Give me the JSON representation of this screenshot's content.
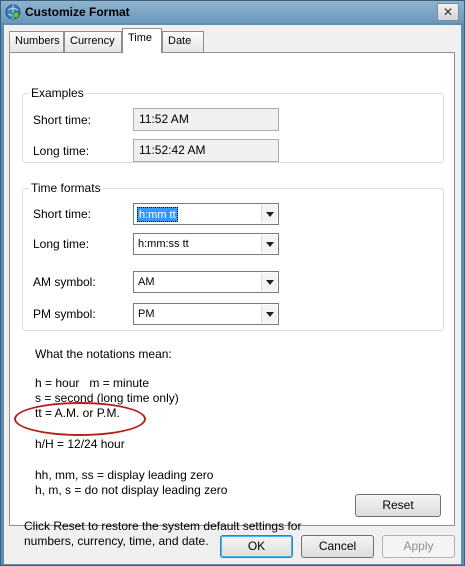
{
  "window": {
    "title": "Customize Format",
    "icon": "control-panel-globe-icon",
    "close_label": "✕"
  },
  "tabs": [
    {
      "label": "Numbers",
      "active": false
    },
    {
      "label": "Currency",
      "active": false
    },
    {
      "label": "Time",
      "active": true
    },
    {
      "label": "Date",
      "active": false
    }
  ],
  "examples": {
    "legend": "Examples",
    "short_time_label": "Short time:",
    "short_time_value": "11:52 AM",
    "long_time_label": "Long time:",
    "long_time_value": "11:52:42 AM"
  },
  "time_formats": {
    "legend": "Time formats",
    "short_time_label": "Short time:",
    "short_time_value": "h:mm tt",
    "long_time_label": "Long time:",
    "long_time_value": "h:mm:ss tt",
    "am_label": "AM symbol:",
    "am_value": "AM",
    "pm_label": "PM symbol:",
    "pm_value": "PM"
  },
  "notations": {
    "heading": "What the notations mean:",
    "line1": "h = hour   m = minute",
    "line2": "s = second (long time only)",
    "line3": "tt = A.M. or P.M.",
    "line4": "h/H = 12/24 hour",
    "line5": "hh, mm, ss = display leading zero",
    "line6": "h, m, s = do not display leading zero"
  },
  "reset": {
    "text_line1": "Click Reset to restore the system default settings for",
    "text_line2": "numbers, currency, time, and date.",
    "button_label": "Reset"
  },
  "footer": {
    "ok_label": "OK",
    "cancel_label": "Cancel",
    "apply_label": "Apply"
  },
  "colors": {
    "annotation_ellipse": "#b3201d",
    "selection": "#3399ff"
  }
}
